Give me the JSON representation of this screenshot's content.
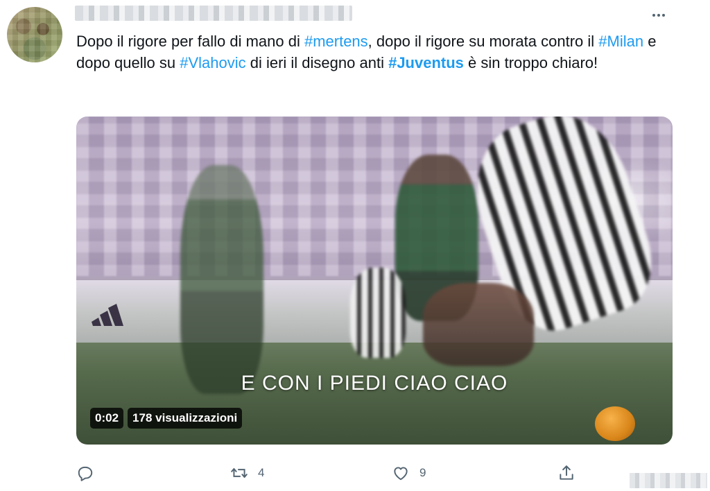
{
  "tweet": {
    "text": {
      "p1": "Dopo il rigore per fallo di mano di ",
      "h1": "#mertens",
      "p2": ", dopo il rigore su morata contro il ",
      "h2": "#Milan",
      "p3": " e dopo quello su ",
      "h3": "#Vlahovic",
      "p4": " di ieri il disegno anti ",
      "h4": "#Juventus",
      "p5": " è sin troppo chiaro!"
    },
    "media": {
      "caption": "E CON I PIEDI CIAO CIAO",
      "duration": "0:02",
      "views": "178 visualizzazioni"
    },
    "actions": {
      "reply": {
        "icon": "reply-icon",
        "count": ""
      },
      "retweet": {
        "icon": "retweet-icon",
        "count": "4"
      },
      "like": {
        "icon": "like-icon",
        "count": "9"
      },
      "share": {
        "icon": "share-icon",
        "count": ""
      }
    }
  },
  "colors": {
    "hashtag": "#1d9bf0",
    "text": "#0f1419",
    "muted": "#536471"
  }
}
